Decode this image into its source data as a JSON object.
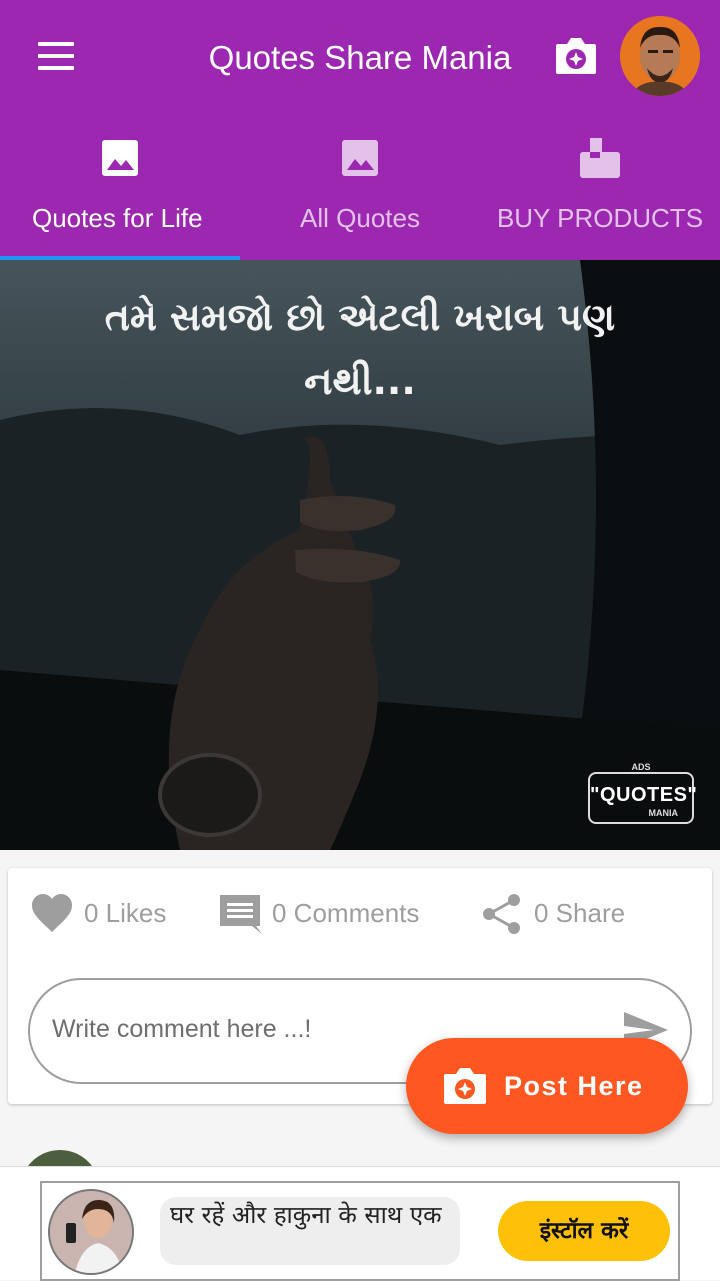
{
  "appbar": {
    "title": "Quotes Share Mania",
    "color": "#9c27b0",
    "menu_icon": "hamburger-menu-icon",
    "camera_icon": "camera-add-icon",
    "avatar_icon": "user-avatar"
  },
  "tabs": [
    {
      "label": "Quotes for Life",
      "icon": "image-icon",
      "active": true
    },
    {
      "label": "All Quotes",
      "icon": "image-icon",
      "active": false
    },
    {
      "label": "BUY PRODUCTS",
      "icon": "mailbox-icon",
      "active": false
    }
  ],
  "tab_indicator_color": "#2196f3",
  "post": {
    "text_line1": "તમે સમજો છો એટલી ખરાબ પણ",
    "text_line2": "નથી...",
    "watermark": {
      "top": "ADS",
      "main": "\"QUOTES\"",
      "sub": "MANIA"
    }
  },
  "actions": {
    "likes": "0 Likes",
    "comments": "0 Comments",
    "share": "0 Share"
  },
  "comment": {
    "placeholder": "Write comment here ...!",
    "send_icon": "send-icon"
  },
  "fab": {
    "label": "Post Here",
    "color": "#ff5722",
    "icon": "camera-add-icon"
  },
  "ad": {
    "text": "घर रहें और हाकुना के साथ एक",
    "button": "इंस्टॉल करें",
    "button_color": "#ffc107"
  }
}
